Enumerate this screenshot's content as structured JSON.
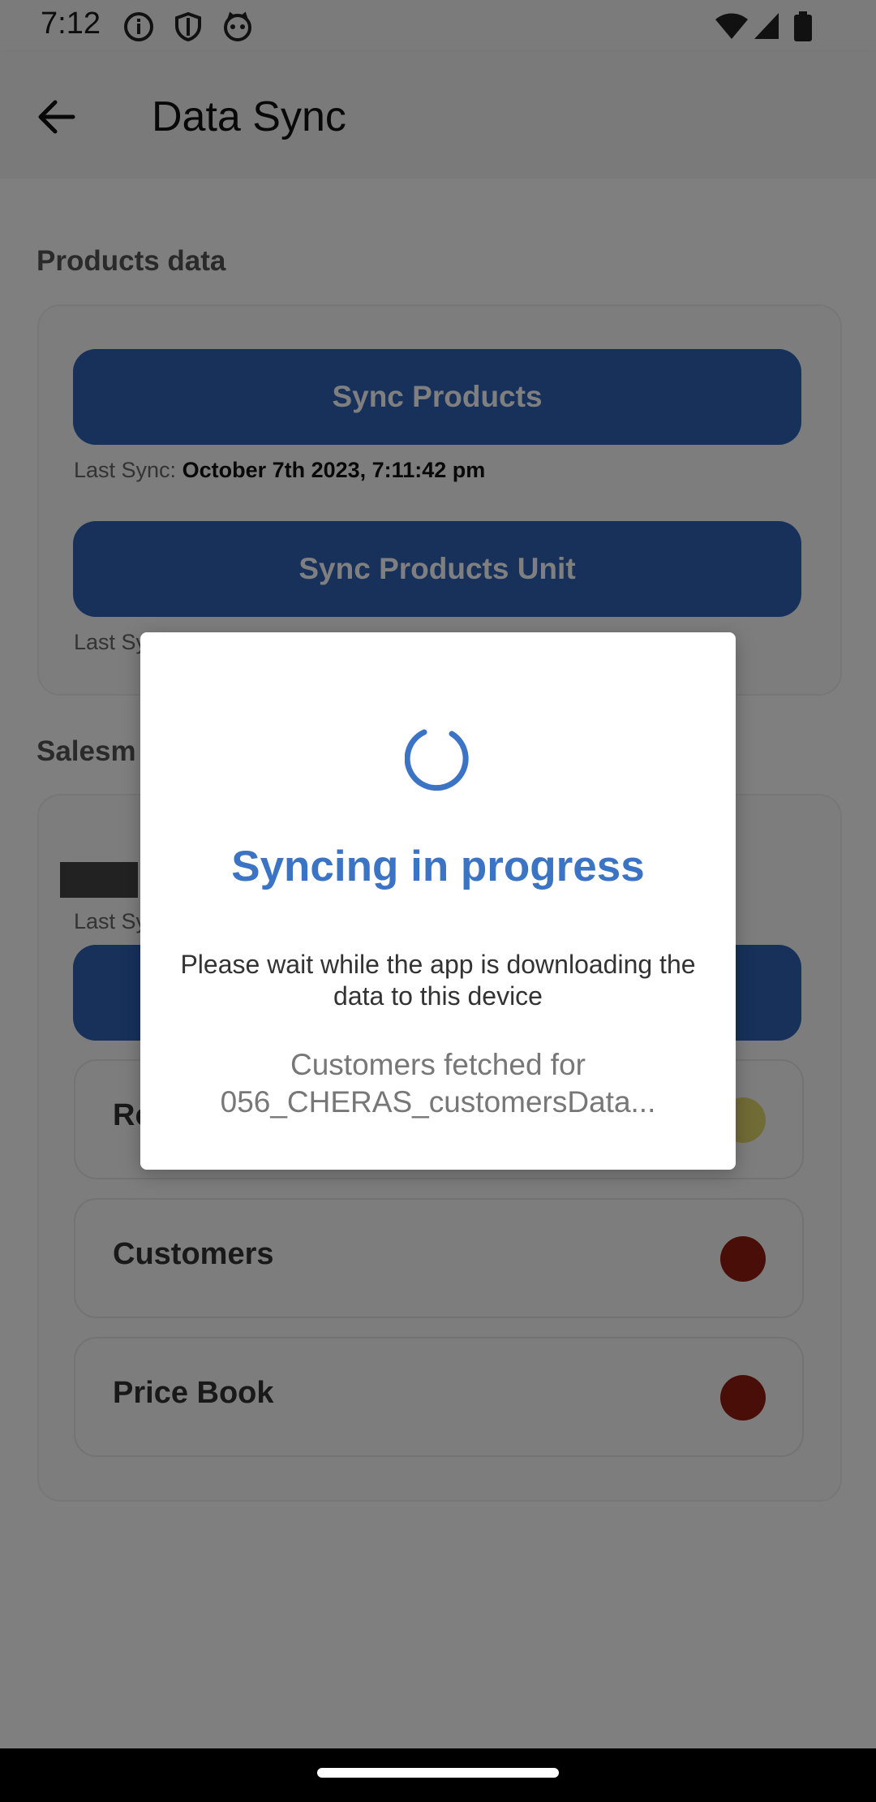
{
  "status_bar": {
    "time": "7:12",
    "icons": [
      "info-icon",
      "shield-icon",
      "cat-icon",
      "wifi-icon",
      "signal-icon",
      "battery-icon"
    ]
  },
  "app_bar": {
    "title": "Data Sync",
    "back_icon": "arrow-back-icon"
  },
  "products_section": {
    "title": "Products data",
    "sync_products_label": "Sync Products",
    "sync_products_last_sync_label": "Last Sync:",
    "sync_products_last_sync_value": "October 7th 2023, 7:11:42 pm",
    "sync_units_label": "Sync Products Unit",
    "sync_units_last_sync_label": "Last Sy"
  },
  "salesman_section": {
    "title": "Salesm",
    "last_sync_label": "Last Sy",
    "items": [
      {
        "label": "Ro",
        "status_color": "#e3d76d"
      },
      {
        "label": "Customers",
        "status_color": "#921c0e"
      },
      {
        "label": "Price Book",
        "status_color": "#921c0e"
      }
    ]
  },
  "dialog": {
    "title": "Syncing in progress",
    "message": "Please wait while the app is downloading the data to this device",
    "status": "Customers fetched for 056_CHERAS_customersData..."
  },
  "colors": {
    "primary": "#2e62b6",
    "dialog_accent": "#3b74c4",
    "status_synced_pending": "#e3d76d",
    "status_not_synced": "#921c0e"
  }
}
